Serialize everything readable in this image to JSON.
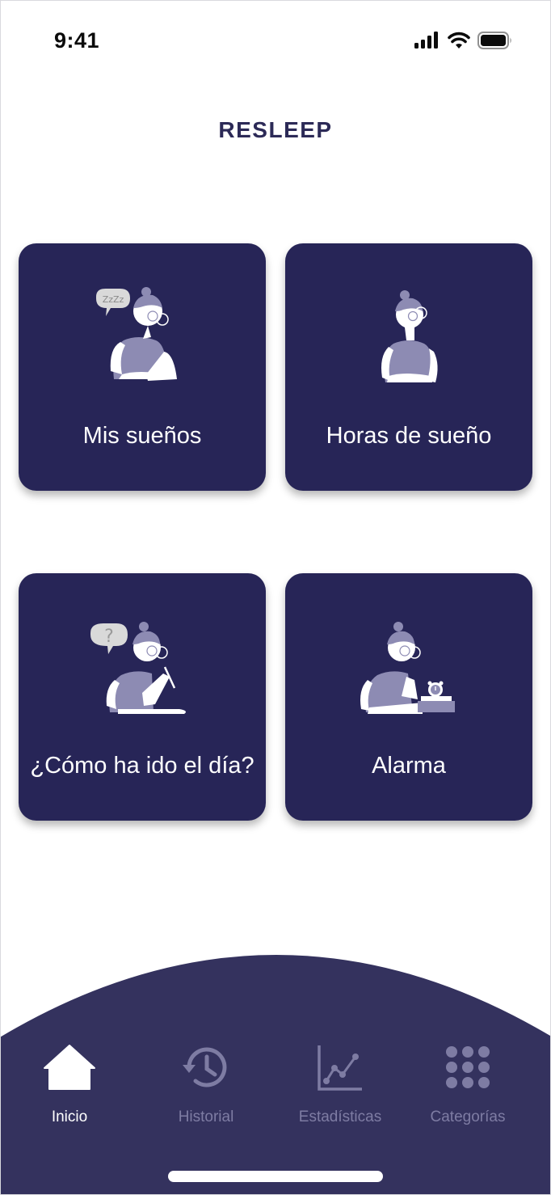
{
  "status_bar": {
    "time": "9:41",
    "icons": [
      "cellular-signal-icon",
      "wifi-icon",
      "battery-icon"
    ]
  },
  "header": {
    "title": "RESLEEP"
  },
  "cards": [
    {
      "label": "Mis sueños",
      "icon": "person-sleeping-illustration"
    },
    {
      "label": "Horas de sueño",
      "icon": "person-resting-illustration"
    },
    {
      "label": "¿Cómo ha ido el día?",
      "icon": "person-writing-illustration"
    },
    {
      "label": "Alarma",
      "icon": "person-with-alarm-clock-illustration"
    }
  ],
  "bubbles": {
    "sleep_text": "ZzZz",
    "question_text": "?"
  },
  "nav": {
    "items": [
      {
        "label": "Inicio",
        "icon": "home-icon",
        "active": true
      },
      {
        "label": "Historial",
        "icon": "history-icon",
        "active": false
      },
      {
        "label": "Estadísticas",
        "icon": "chart-icon",
        "active": false
      },
      {
        "label": "Categorías",
        "icon": "grid-icon",
        "active": false
      }
    ]
  },
  "colors": {
    "card": "#272557",
    "nav_background": "#34325e",
    "title": "#2c2a57",
    "nav_active": "#ffffff",
    "nav_inactive": "#7e7ca3"
  }
}
